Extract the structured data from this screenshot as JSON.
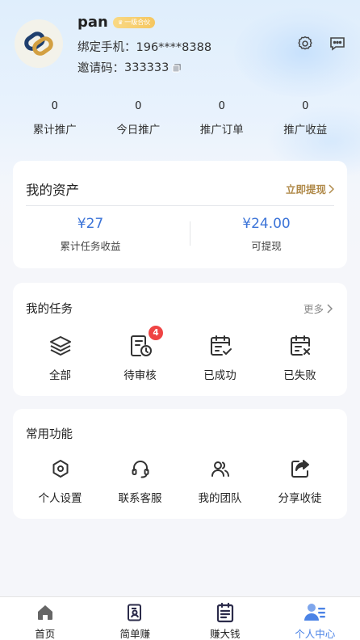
{
  "profile": {
    "username": "pan",
    "badge": "一级合伙",
    "phone_label": "绑定手机：",
    "phone": "196****8388",
    "invite_label": "邀请码：",
    "invite_code": "333333"
  },
  "stats": [
    {
      "value": "0",
      "label": "累计推广"
    },
    {
      "value": "0",
      "label": "今日推广"
    },
    {
      "value": "0",
      "label": "推广订单"
    },
    {
      "value": "0",
      "label": "推广收益"
    }
  ],
  "assets": {
    "title": "我的资产",
    "withdraw_link": "立即提现",
    "total_value": "¥27",
    "total_label": "累计任务收益",
    "available_value": "¥24.00",
    "available_label": "可提现"
  },
  "tasks": {
    "title": "我的任务",
    "more": "更多",
    "items": [
      {
        "label": "全部",
        "icon": "layers-icon"
      },
      {
        "label": "待审核",
        "icon": "pending-review-icon",
        "badge": "4"
      },
      {
        "label": "已成功",
        "icon": "calendar-check-icon"
      },
      {
        "label": "已失败",
        "icon": "calendar-x-icon"
      }
    ]
  },
  "functions": {
    "title": "常用功能",
    "items": [
      {
        "label": "个人设置",
        "icon": "settings-hex-icon"
      },
      {
        "label": "联系客服",
        "icon": "headset-icon"
      },
      {
        "label": "我的团队",
        "icon": "team-icon"
      },
      {
        "label": "分享收徒",
        "icon": "share-icon"
      }
    ]
  },
  "tabbar": {
    "items": [
      {
        "label": "首页",
        "icon": "home-icon",
        "active": false
      },
      {
        "label": "简单赚",
        "icon": "simple-earn-icon",
        "active": false
      },
      {
        "label": "赚大钱",
        "icon": "big-earn-icon",
        "active": false
      },
      {
        "label": "个人中心",
        "icon": "profile-icon",
        "active": true
      }
    ]
  },
  "colors": {
    "accent": "#4b83e6",
    "money": "#3c74d8",
    "gold": "#b08a4a",
    "badge_red": "#ef4444"
  }
}
